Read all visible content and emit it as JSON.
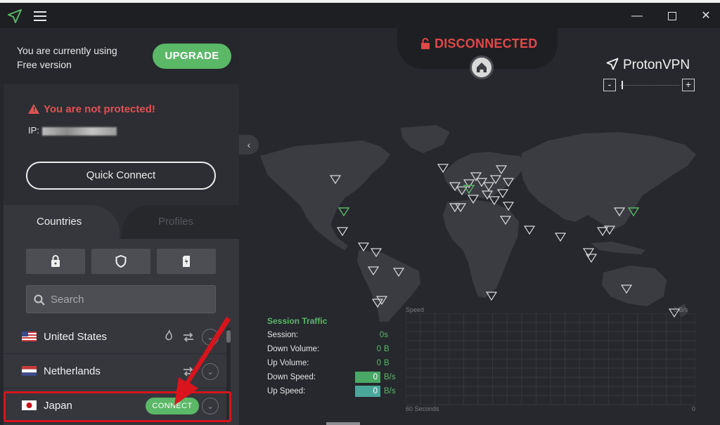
{
  "window": {
    "controls": {
      "minimize": "—",
      "close": "✕"
    }
  },
  "sidebar": {
    "usage_line1": "You are currently using",
    "usage_line2": "Free version",
    "upgrade_label": "UPGRADE",
    "warning": "You are not protected!",
    "ip_label": "IP:",
    "quick_connect_label": "Quick Connect",
    "tabs": [
      {
        "label": "Countries",
        "active": true
      },
      {
        "label": "Profiles",
        "active": false
      }
    ],
    "filters": [
      {
        "icon": "lock-icon"
      },
      {
        "icon": "shield-icon"
      },
      {
        "icon": "tor-onion-card-icon"
      }
    ],
    "search": {
      "placeholder": "Search"
    },
    "countries": [
      {
        "name": "United States",
        "features": [
          "tor-icon",
          "p2p-arrows-icon"
        ]
      },
      {
        "name": "Netherlands",
        "features": [
          "p2p-arrows-icon"
        ]
      },
      {
        "name": "Japan",
        "connect_label": "CONNECT",
        "highlighted": true
      }
    ]
  },
  "map": {
    "status": "DISCONNECTED",
    "brand": "ProtonVPN",
    "zoom_minus": "-",
    "zoom_plus": "+",
    "collapse": "‹"
  },
  "traffic": {
    "title": "Session Traffic",
    "rows": [
      {
        "label": "Session:",
        "value": "0s",
        "unit": ""
      },
      {
        "label": "Down Volume:",
        "value": "0",
        "unit": "B"
      },
      {
        "label": "Up Volume:",
        "value": "0",
        "unit": "B"
      },
      {
        "label": "Down Speed:",
        "value": "0",
        "unit": "B/s"
      },
      {
        "label": "Up Speed:",
        "value": "0",
        "unit": "B/s"
      }
    ],
    "graph": {
      "label": "Speed",
      "unit": "0 B/s",
      "x_start": "60 Seconds",
      "x_end": "0"
    }
  },
  "colors": {
    "accent": "#5bb867",
    "danger": "#e04848",
    "annotation": "#d9141c"
  }
}
